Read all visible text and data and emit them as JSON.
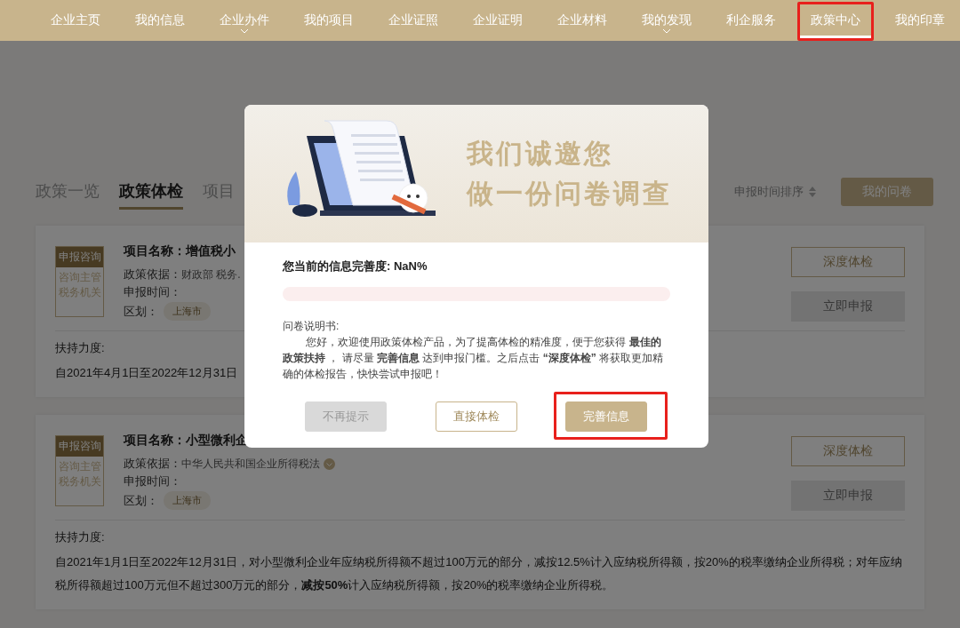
{
  "nav": {
    "items": [
      {
        "label": "企业主页",
        "selected": false,
        "has_menu": false,
        "highlighted": false
      },
      {
        "label": "我的信息",
        "selected": false,
        "has_menu": false,
        "highlighted": false
      },
      {
        "label": "企业办件",
        "selected": false,
        "has_menu": true,
        "highlighted": false
      },
      {
        "label": "我的项目",
        "selected": false,
        "has_menu": false,
        "highlighted": false
      },
      {
        "label": "企业证照",
        "selected": false,
        "has_menu": false,
        "highlighted": false
      },
      {
        "label": "企业证明",
        "selected": false,
        "has_menu": false,
        "highlighted": false
      },
      {
        "label": "企业材料",
        "selected": false,
        "has_menu": false,
        "highlighted": false
      },
      {
        "label": "我的发现",
        "selected": false,
        "has_menu": true,
        "highlighted": false
      },
      {
        "label": "利企服务",
        "selected": false,
        "has_menu": false,
        "highlighted": false
      },
      {
        "label": "政策中心",
        "selected": true,
        "has_menu": false,
        "highlighted": true
      },
      {
        "label": "我的印章",
        "selected": false,
        "has_menu": false,
        "highlighted": false
      }
    ]
  },
  "tabs": [
    {
      "label": "政策一览",
      "selected": false
    },
    {
      "label": "政策体检",
      "selected": true
    },
    {
      "label": "项目",
      "selected": false
    }
  ],
  "sort": {
    "label": "申报时间排序"
  },
  "my_survey_button": "我的问卷",
  "cards": [
    {
      "tag": "申报咨询",
      "tag_note": "咨询主管税务机关",
      "title_label": "项目名称：",
      "title": "增值税小",
      "basis_label": "政策依据：",
      "basis": "财政部 税务.",
      "time_label": "申报时间：",
      "region_label": "区划：",
      "region": "上海市",
      "support_label": "扶持力度:",
      "support": "自2021年4月1日至2022年12月31日",
      "buttons": [
        {
          "label": "深度体检",
          "disabled": false
        },
        {
          "label": "立即申报",
          "disabled": true
        }
      ]
    },
    {
      "tag": "申报咨询",
      "tag_note": "咨询主管税务机关",
      "title_label": "项目名称：",
      "title": "小型微利企",
      "basis_label": "政策依据：",
      "basis": "中华人民共和国企业所得税法",
      "basis_verified": true,
      "time_label": "申报时间：",
      "region_label": "区划：",
      "region": "上海市",
      "support_label": "扶持力度:",
      "support": "自2021年1月1日至2022年12月31日，对小型微利企业年应纳税所得额不超过100万元的部分，减按12.5%计入应纳税所得额，按20%的税率缴纳企业所得税；对年应纳税所得额超过100万元但不超过300万元的部分，**减按50%**计入应纳税所得额，按20%的税率缴纳企业所得税。",
      "buttons": [
        {
          "label": "深度体检",
          "disabled": false
        },
        {
          "label": "立即申报",
          "disabled": true
        }
      ]
    }
  ],
  "modal": {
    "title_lines": [
      "我们诚邀您",
      "做一份问卷调查"
    ],
    "completeness": "您当前的信息完善度: NaN%",
    "level": 0,
    "intro_label": "问卷说明书:",
    "intro": "您好，欢迎使用政策体检产品，为了提高体检的精准度，便于您获得 **最佳的政策扶持** ， 请尽量 **完善信息** 达到申报门槛。之后点击 **“深度体检”** 将获取更加精确的体检报告，快快尝试申报吧！",
    "buttons": [
      {
        "label": "不再提示",
        "kind": "muted",
        "highlighted": false
      },
      {
        "label": "直接体检",
        "kind": "outline",
        "highlighted": false
      },
      {
        "label": "完善信息",
        "kind": "primary",
        "highlighted": true
      }
    ]
  }
}
